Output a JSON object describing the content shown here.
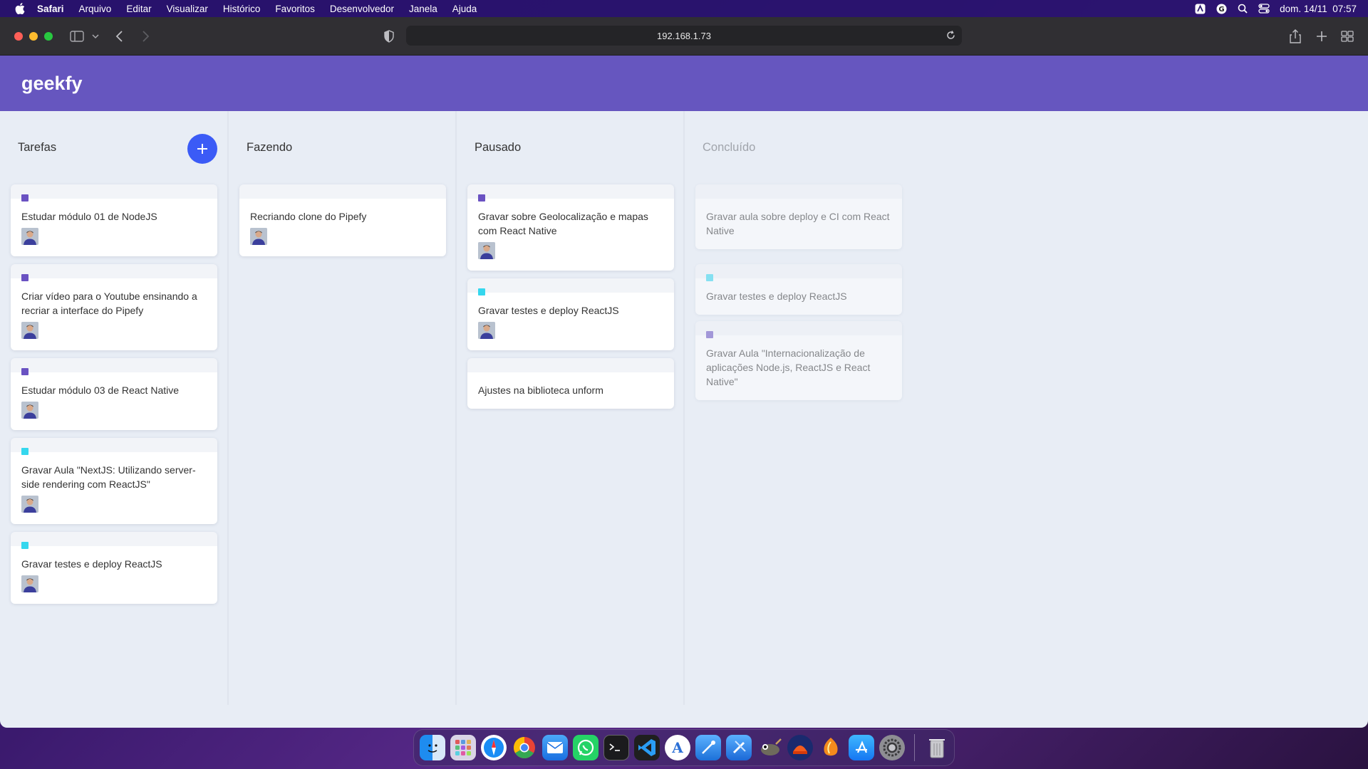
{
  "menubar": {
    "items": [
      "Safari",
      "Arquivo",
      "Editar",
      "Visualizar",
      "Histórico",
      "Favoritos",
      "Desenvolvedor",
      "Janela",
      "Ajuda"
    ],
    "clock": "dom. 14/11  07:57",
    "status_icons": [
      "adobe-icon",
      "grammarly-icon",
      "search-icon",
      "control-center-icon"
    ]
  },
  "browser": {
    "url": "192.168.1.73"
  },
  "app": {
    "logo": "geekfy"
  },
  "board": {
    "columns": [
      {
        "title": "Tarefas",
        "done": false,
        "cards": [
          {
            "label_color": "#6a52c2",
            "content": "Estudar módulo 01 de NodeJS",
            "has_user": true
          },
          {
            "label_color": "#6a52c2",
            "content": "Criar vídeo para o Youtube ensinando a recriar a interface do Pipefy",
            "has_user": true
          },
          {
            "label_color": "#6a52c2",
            "content": "Estudar módulo 03 de React Native",
            "has_user": true
          },
          {
            "label_color": "#35d7ee",
            "content": "Gravar Aula \"NextJS: Utilizando server-side rendering com ReactJS\"",
            "has_user": true
          },
          {
            "label_color": "#35d7ee",
            "content": "Gravar testes e deploy ReactJS",
            "has_user": true
          }
        ]
      },
      {
        "title": "Fazendo",
        "done": false,
        "cards": [
          {
            "label_color": "",
            "content": "Recriando clone do Pipefy",
            "has_user": true
          }
        ]
      },
      {
        "title": "Pausado",
        "done": false,
        "cards": [
          {
            "label_color": "#6a52c2",
            "content": "Gravar sobre Geolocalização e mapas com React Native",
            "has_user": true
          },
          {
            "label_color": "#35d7ee",
            "content": "Gravar testes e deploy ReactJS",
            "has_user": true
          },
          {
            "label_color": "",
            "content": "Ajustes na biblioteca unform",
            "has_user": false
          }
        ]
      },
      {
        "title": "Concluído",
        "done": true,
        "cards": [
          {
            "label_color": "",
            "content": "Gravar aula sobre deploy e CI com React Native",
            "has_user": false
          },
          {
            "label_color": "#35d7ee",
            "content": "Gravar testes e deploy ReactJS",
            "has_user": false
          },
          {
            "label_color": "#6a52c2",
            "content": "Gravar Aula \"Internacionalização de aplicações Node.js, ReactJS e React Native\"",
            "has_user": false
          }
        ]
      }
    ]
  },
  "dock": {
    "apps": [
      "finder-icon",
      "launchpad-icon",
      "safari-icon",
      "chrome-icon",
      "mail-icon",
      "whatsapp-icon",
      "terminal-icon",
      "vscode-icon",
      "font-app-icon",
      "simulator-icon",
      "xcode-icon",
      "gimp-icon",
      "medal-icon",
      "fl-studio-icon",
      "app-store-icon",
      "system-preferences-icon"
    ],
    "trash": "trash-icon"
  }
}
